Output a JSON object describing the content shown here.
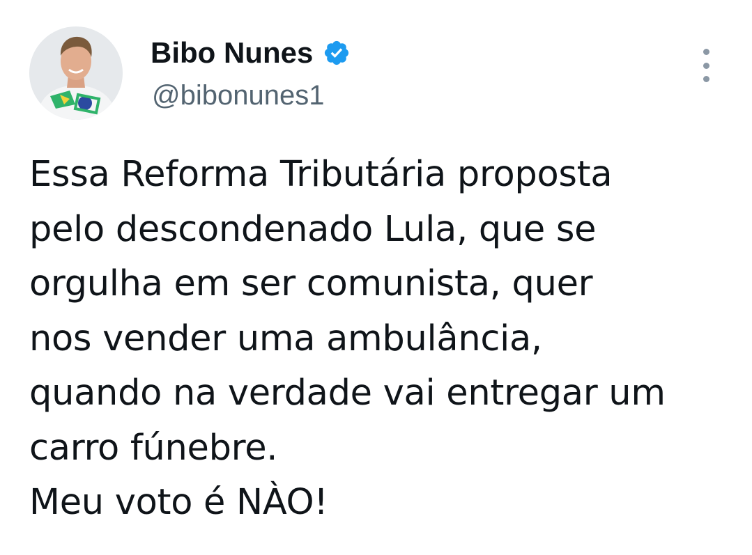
{
  "author": {
    "display_name": "Bibo Nunes",
    "handle": "@bibonunes1",
    "verified": true,
    "verified_icon": "verified-badge-icon",
    "avatar_icon": "profile-photo"
  },
  "tweet": {
    "lines": [
      "Essa Reforma Tributária proposta",
      "pelo descondenado Lula, que se",
      "orgulha em ser comunista, quer",
      "nos vender uma ambulância,",
      "quando na verdade vai entregar um",
      "carro fúnebre.",
      "Meu voto é NÀO!"
    ]
  },
  "menu": {
    "icon": "more-vertical-icon"
  },
  "colors": {
    "text_primary": "#0f1419",
    "text_secondary": "#536471",
    "verified_blue": "#1d9bf0",
    "menu_dots": "#8b98a5"
  }
}
